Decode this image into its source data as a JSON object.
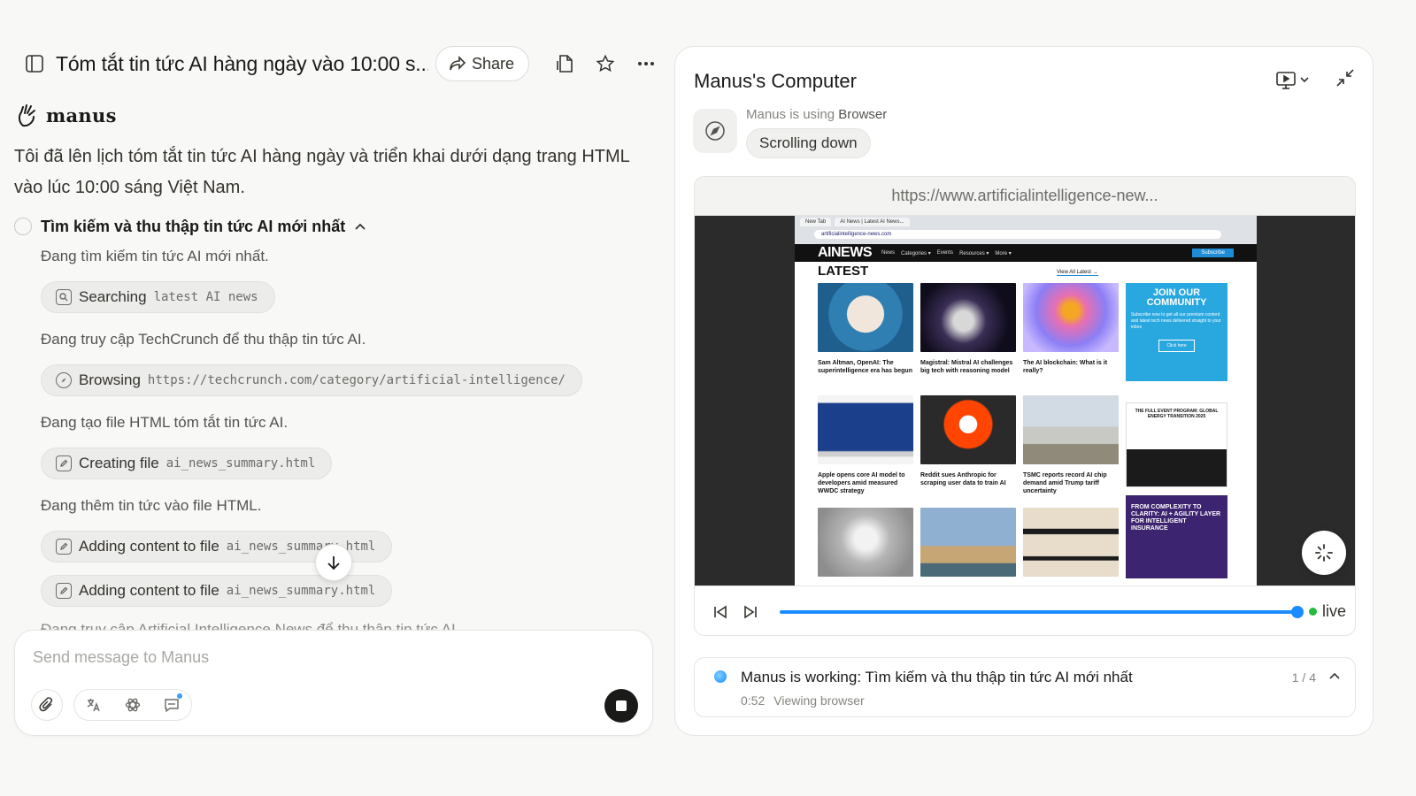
{
  "header": {
    "title": "Tóm tắt tin tức AI hàng ngày vào 10:00 s...",
    "share_label": "Share"
  },
  "brand": {
    "name": "manus"
  },
  "chat": {
    "intro": "Tôi đã lên lịch tóm tắt tin tức AI hàng ngày và triển khai dưới dạng trang HTML vào lúc 10:00 sáng Việt Nam.",
    "task_title": "Tìm kiếm và thu thập tin tức AI mới nhất",
    "steps": [
      {
        "text": "Đang tìm kiếm tin tức AI mới nhất.",
        "action": "Searching",
        "arg": "latest AI news"
      },
      {
        "text": "Đang truy cập TechCrunch để thu thập tin tức AI.",
        "action": "Browsing",
        "arg": "https://techcrunch.com/category/artificial-intelligence/"
      },
      {
        "text": "Đang tạo file HTML tóm tắt tin tức AI.",
        "action": "Creating file",
        "arg": "ai_news_summary.html"
      },
      {
        "text": "Đang thêm tin tức vào file HTML.",
        "action": "Adding content to file",
        "arg": "ai_news_summary.html"
      },
      {
        "text": "",
        "action": "Adding content to file",
        "arg": "ai_news_summary.html"
      }
    ],
    "cut_off_text": "Đang truy cập Artificial Intelligence News để thu thập tin tức AI"
  },
  "composer": {
    "placeholder": "Send message to Manus"
  },
  "computer": {
    "title": "Manus's Computer",
    "using_prefix": "Manus is using",
    "using_tool": "Browser",
    "action": "Scrolling down",
    "url": "https://www.artificialintelligence-new...",
    "live_label": "live",
    "progress": 0.99
  },
  "screenshot": {
    "tabs": [
      "New Tab",
      "AI News | Latest AI News..."
    ],
    "address": "artificialintelligence-news.com",
    "logo": "AINEWS",
    "nav": [
      "News",
      "Categories ▾",
      "Events",
      "Resources ▾",
      "More ▾"
    ],
    "subscribe": "Subscribe",
    "latest": "LATEST",
    "view_all": "View All Latest →",
    "cards": [
      {
        "caption": "Sam Altman, OpenAI: The superintelligence era has begun"
      },
      {
        "caption": "Magistral: Mistral AI challenges big tech with reasoning model"
      },
      {
        "caption": "The AI blockchain: What is it really?"
      },
      {
        "caption": "Apple opens core AI model to developers amid measured WWDC strategy"
      },
      {
        "caption": "Reddit sues Anthropic for scraping user data to train AI"
      },
      {
        "caption": "TSMC reports record AI chip demand amid Trump tariff uncertainty"
      },
      {
        "caption": ""
      },
      {
        "caption": ""
      },
      {
        "caption": ""
      }
    ],
    "join_title": "JOIN OUR COMMUNITY",
    "join_desc": "Subscribe now to get all our premium content and latest tech news delivered straight to your inbox",
    "join_button": "Click here",
    "ad1_title": "THE FULL EVENT PROGRAM: GLOBAL ENERGY TRANSITION 2025",
    "ad2_title": "FROM COMPLEXITY TO CLARITY: AI + AGILITY LAYER FOR INTELLIGENT INSURANCE"
  },
  "status": {
    "text": "Manus is working: Tìm kiếm và thu thập tin tức AI mới nhất",
    "time": "0:52",
    "activity": "Viewing browser",
    "count": "1 / 4"
  },
  "colors": {
    "accent": "#1a8cff",
    "live": "#25ba3b",
    "bg": "#f8f8f7"
  }
}
